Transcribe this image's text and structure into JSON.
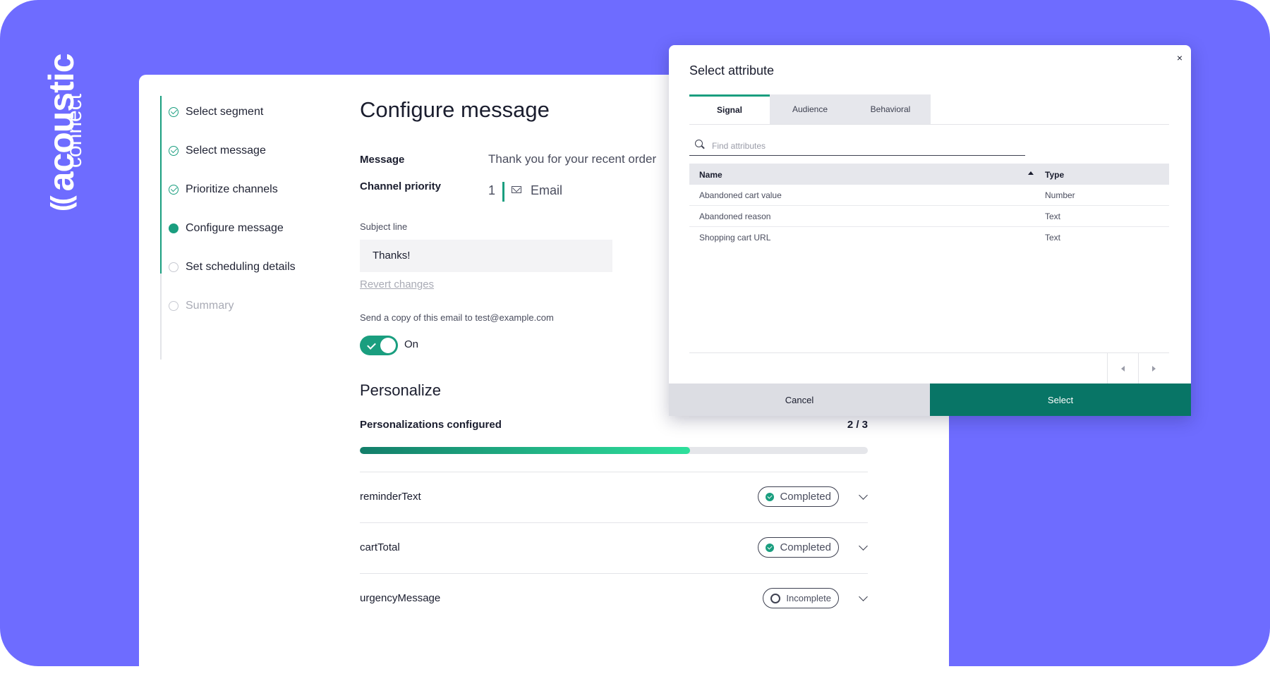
{
  "brand": {
    "name": "acoustic",
    "product": "connect",
    "mark": "(("
  },
  "steps": [
    {
      "label": "Select segment",
      "state": "done"
    },
    {
      "label": "Select message",
      "state": "done"
    },
    {
      "label": "Prioritize channels",
      "state": "done"
    },
    {
      "label": "Configure message",
      "state": "current"
    },
    {
      "label": "Set scheduling details",
      "state": "todo"
    },
    {
      "label": "Summary",
      "state": "todo"
    }
  ],
  "configure": {
    "title": "Configure message",
    "message_label": "Message",
    "message_value": "Thank you for your recent order",
    "channel_priority_label": "Channel priority",
    "channel_priority_number": "1",
    "channel_name": "Email",
    "subject_label": "Subject line",
    "subject_value": "Thanks!",
    "revert_label": "Revert changes",
    "copy_label": "Send a copy of this email to test@example.com",
    "toggle_label": "On"
  },
  "personalize": {
    "title": "Personalize",
    "configured_label": "Personalizations configured",
    "configured_count": "2 / 3",
    "progress_percent": 65,
    "items": [
      {
        "name": "reminderText",
        "status": "Completed"
      },
      {
        "name": "cartTotal",
        "status": "Completed"
      },
      {
        "name": "urgencyMessage",
        "status": "Incomplete"
      }
    ]
  },
  "modal": {
    "title": "Select attribute",
    "close": "×",
    "tabs": [
      "Signal",
      "Audience",
      "Behavioral"
    ],
    "active_tab": "Signal",
    "search_placeholder": "Find attributes",
    "columns": [
      "Name",
      "Type"
    ],
    "rows": [
      {
        "name": "Abandoned cart value",
        "type": "Number"
      },
      {
        "name": "Abandoned reason",
        "type": "Text"
      },
      {
        "name": "Shopping cart URL",
        "type": "Text"
      }
    ],
    "cancel_label": "Cancel",
    "select_label": "Select"
  },
  "colors": {
    "background": "#6e6cff",
    "accent": "#1a9e7f",
    "select_button": "#087566"
  }
}
